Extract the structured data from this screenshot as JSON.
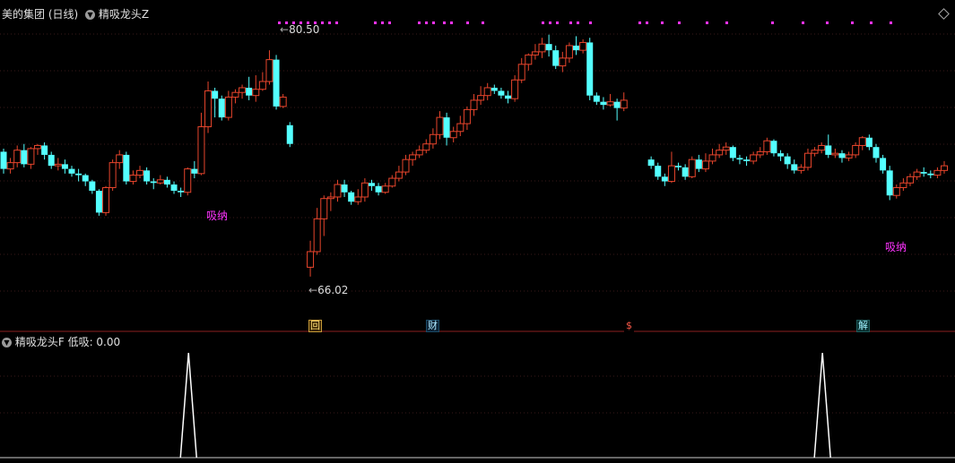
{
  "top": {
    "stock_title": "美的集团 (日线)",
    "indicator_name": "精吸龙头Z",
    "high_label": "80.50",
    "low_label": "66.02",
    "signal_label": "吸纳"
  },
  "markers": [
    "回",
    "财",
    "$",
    "解"
  ],
  "bottom": {
    "indicator_name": "精吸龙头F",
    "value_text": "低吸: 0.00"
  },
  "colors": {
    "up": "#e8452c",
    "down": "#54ffff",
    "signal": "#ff33ff",
    "grid": "#3a1a1a",
    "separator": "#8b1f1f"
  },
  "chart_data": {
    "type": "candlestick",
    "price_range": [
      64.5,
      82.0
    ],
    "high": 80.5,
    "low": 66.02,
    "candles": [
      [
        74.0,
        72.9,
        74.2,
        72.6
      ],
      [
        72.9,
        73.3,
        73.6,
        72.6
      ],
      [
        73.3,
        74.1,
        74.4,
        73.0
      ],
      [
        74.1,
        73.2,
        74.5,
        73.0
      ],
      [
        73.2,
        74.2,
        74.3,
        72.9
      ],
      [
        74.2,
        74.4,
        74.5,
        73.8
      ],
      [
        74.4,
        73.8,
        74.6,
        73.5
      ],
      [
        73.8,
        73.1,
        74.0,
        72.9
      ],
      [
        73.1,
        73.2,
        73.6,
        72.8
      ],
      [
        73.2,
        72.9,
        73.5,
        72.6
      ],
      [
        72.9,
        72.6,
        73.1,
        72.4
      ],
      [
        72.6,
        72.5,
        72.9,
        72.1
      ],
      [
        72.5,
        72.1,
        72.6,
        71.8
      ],
      [
        72.1,
        71.5,
        72.2,
        71.3
      ],
      [
        71.5,
        70.1,
        71.6,
        69.9
      ],
      [
        70.1,
        71.7,
        71.8,
        69.9
      ],
      [
        71.7,
        73.3,
        73.5,
        71.5
      ],
      [
        73.3,
        73.8,
        74.1,
        72.9
      ],
      [
        73.8,
        72.1,
        74.0,
        71.9
      ],
      [
        72.1,
        72.5,
        72.8,
        71.9
      ],
      [
        72.5,
        72.8,
        73.1,
        72.3
      ],
      [
        72.8,
        72.1,
        73.0,
        71.9
      ],
      [
        72.1,
        72.0,
        72.3,
        71.6
      ],
      [
        72.0,
        72.2,
        72.5,
        71.9
      ],
      [
        72.2,
        71.9,
        72.4,
        71.7
      ],
      [
        71.9,
        71.5,
        72.1,
        71.3
      ],
      [
        71.5,
        71.4,
        71.7,
        71.1
      ],
      [
        71.4,
        72.9,
        73.0,
        71.2
      ],
      [
        72.9,
        72.6,
        73.4,
        72.3
      ],
      [
        72.6,
        75.6,
        76.5,
        72.5
      ],
      [
        75.6,
        77.9,
        78.5,
        75.2
      ],
      [
        77.9,
        77.4,
        78.1,
        76.2
      ],
      [
        77.4,
        76.2,
        77.6,
        76.0
      ],
      [
        76.2,
        77.5,
        77.9,
        76.0
      ],
      [
        77.5,
        77.8,
        78.0,
        77.1
      ],
      [
        77.8,
        78.1,
        78.3,
        77.4
      ],
      [
        78.1,
        77.6,
        78.8,
        77.3
      ],
      [
        77.6,
        78.0,
        78.9,
        77.2
      ],
      [
        78.0,
        78.5,
        79.1,
        77.9
      ],
      [
        78.5,
        79.9,
        80.5,
        78.3
      ],
      [
        79.9,
        76.9,
        80.2,
        76.7
      ],
      [
        76.9,
        77.5,
        77.7,
        76.8
      ],
      [
        75.7,
        74.5,
        75.9,
        74.3
      ],
      [
        null,
        null,
        null,
        null
      ],
      [
        null,
        null,
        null,
        null
      ],
      [
        66.6,
        67.6,
        68.3,
        66.0
      ],
      [
        67.6,
        69.7,
        70.4,
        67.4
      ],
      [
        69.7,
        71.0,
        71.2,
        68.6
      ],
      [
        71.0,
        71.1,
        71.4,
        70.2
      ],
      [
        71.1,
        71.9,
        72.2,
        70.8
      ],
      [
        71.9,
        71.4,
        72.2,
        71.1
      ],
      [
        71.4,
        70.8,
        71.5,
        70.6
      ],
      [
        70.8,
        71.1,
        71.6,
        70.6
      ],
      [
        71.1,
        72.0,
        72.3,
        70.8
      ],
      [
        72.0,
        71.8,
        72.2,
        71.5
      ],
      [
        71.8,
        71.4,
        72.0,
        71.2
      ],
      [
        71.4,
        71.8,
        72.0,
        71.3
      ],
      [
        71.8,
        72.3,
        72.5,
        71.7
      ],
      [
        72.3,
        72.7,
        73.1,
        72.1
      ],
      [
        72.7,
        73.5,
        73.8,
        72.5
      ],
      [
        73.5,
        73.8,
        74.0,
        73.1
      ],
      [
        73.8,
        74.1,
        74.4,
        73.6
      ],
      [
        74.1,
        74.5,
        74.8,
        73.9
      ],
      [
        74.5,
        75.1,
        75.5,
        74.2
      ],
      [
        75.1,
        76.2,
        76.6,
        74.8
      ],
      [
        76.2,
        74.9,
        76.5,
        74.4
      ],
      [
        74.9,
        75.3,
        75.6,
        74.6
      ],
      [
        75.3,
        75.8,
        76.3,
        75.0
      ],
      [
        75.8,
        76.7,
        76.9,
        75.4
      ],
      [
        76.7,
        77.3,
        77.7,
        76.3
      ],
      [
        77.3,
        77.6,
        78.2,
        77.0
      ],
      [
        77.6,
        78.1,
        78.4,
        77.3
      ],
      [
        78.1,
        77.9,
        78.3,
        77.7
      ],
      [
        77.9,
        77.6,
        78.1,
        77.4
      ],
      [
        77.6,
        77.4,
        77.9,
        77.1
      ],
      [
        77.4,
        78.6,
        78.9,
        77.2
      ],
      [
        78.6,
        79.6,
        80.0,
        78.4
      ],
      [
        79.6,
        80.2,
        80.3,
        79.2
      ],
      [
        80.2,
        80.4,
        80.9,
        79.9
      ],
      [
        80.4,
        80.9,
        81.3,
        80.0
      ],
      [
        80.9,
        80.5,
        81.5,
        80.1
      ],
      [
        80.5,
        79.5,
        80.8,
        79.3
      ],
      [
        79.5,
        80.0,
        80.4,
        79.1
      ],
      [
        80.0,
        80.8,
        81.0,
        79.7
      ],
      [
        80.8,
        80.5,
        81.4,
        80.2
      ],
      [
        80.5,
        81.0,
        81.2,
        80.3
      ],
      [
        81.0,
        77.6,
        81.3,
        77.3
      ],
      [
        77.6,
        77.2,
        77.8,
        77.0
      ],
      [
        77.2,
        77.0,
        77.5,
        76.7
      ],
      [
        77.0,
        77.2,
        77.7,
        76.9
      ],
      [
        77.2,
        76.8,
        77.4,
        76.0
      ],
      [
        76.8,
        77.3,
        77.8,
        76.6
      ],
      [
        null,
        null,
        null,
        null
      ],
      [
        null,
        null,
        null,
        null
      ],
      [
        null,
        null,
        null,
        null
      ],
      [
        73.5,
        73.1,
        73.7,
        72.9
      ],
      [
        73.1,
        72.4,
        73.3,
        72.2
      ],
      [
        72.4,
        72.1,
        72.6,
        71.8
      ],
      [
        72.1,
        73.1,
        74.0,
        72.0
      ],
      [
        73.1,
        73.0,
        73.3,
        72.8
      ],
      [
        73.0,
        72.4,
        73.2,
        72.2
      ],
      [
        72.4,
        73.5,
        73.7,
        72.3
      ],
      [
        73.5,
        72.9,
        73.8,
        72.7
      ],
      [
        72.9,
        73.4,
        73.9,
        72.7
      ],
      [
        73.4,
        73.8,
        74.2,
        73.2
      ],
      [
        73.8,
        74.1,
        74.5,
        73.6
      ],
      [
        74.1,
        74.3,
        74.6,
        73.8
      ],
      [
        74.3,
        73.6,
        74.4,
        73.4
      ],
      [
        73.6,
        73.5,
        73.8,
        73.2
      ],
      [
        73.5,
        73.4,
        73.7,
        73.1
      ],
      [
        73.4,
        73.8,
        74.0,
        73.2
      ],
      [
        73.8,
        74.0,
        74.3,
        73.6
      ],
      [
        74.0,
        74.7,
        74.9,
        73.8
      ],
      [
        74.7,
        73.9,
        74.8,
        73.7
      ],
      [
        73.9,
        73.7,
        74.1,
        73.4
      ],
      [
        73.7,
        73.2,
        73.9,
        72.9
      ],
      [
        73.2,
        72.8,
        73.5,
        72.6
      ],
      [
        72.8,
        73.0,
        73.2,
        72.6
      ],
      [
        73.0,
        73.9,
        74.2,
        72.8
      ],
      [
        73.9,
        74.1,
        74.3,
        73.7
      ],
      [
        74.1,
        74.4,
        74.6,
        73.9
      ],
      [
        74.4,
        73.8,
        75.1,
        73.6
      ],
      [
        73.8,
        73.9,
        74.2,
        73.6
      ],
      [
        73.9,
        73.6,
        74.1,
        73.3
      ],
      [
        73.6,
        73.8,
        74.0,
        73.4
      ],
      [
        73.8,
        74.4,
        74.6,
        73.6
      ],
      [
        74.4,
        74.9,
        75.0,
        74.1
      ],
      [
        74.9,
        74.3,
        75.1,
        74.1
      ],
      [
        74.3,
        73.6,
        74.5,
        73.3
      ],
      [
        73.6,
        72.8,
        73.8,
        72.6
      ],
      [
        72.8,
        71.2,
        73.1,
        70.9
      ],
      [
        71.2,
        71.7,
        71.9,
        71.0
      ],
      [
        71.7,
        72.0,
        72.3,
        71.5
      ],
      [
        72.0,
        72.4,
        72.6,
        71.8
      ],
      [
        72.4,
        72.7,
        72.9,
        72.2
      ],
      [
        72.7,
        72.6,
        73.0,
        72.4
      ],
      [
        72.6,
        72.5,
        72.8,
        72.3
      ],
      [
        72.5,
        72.8,
        73.0,
        72.3
      ],
      [
        72.8,
        73.1,
        73.4,
        72.6
      ]
    ],
    "top_signal_dots": true,
    "bottom_indicator": {
      "name": "低吸",
      "value": 0.0,
      "spikes_at_candle": [
        27,
        120
      ]
    }
  }
}
